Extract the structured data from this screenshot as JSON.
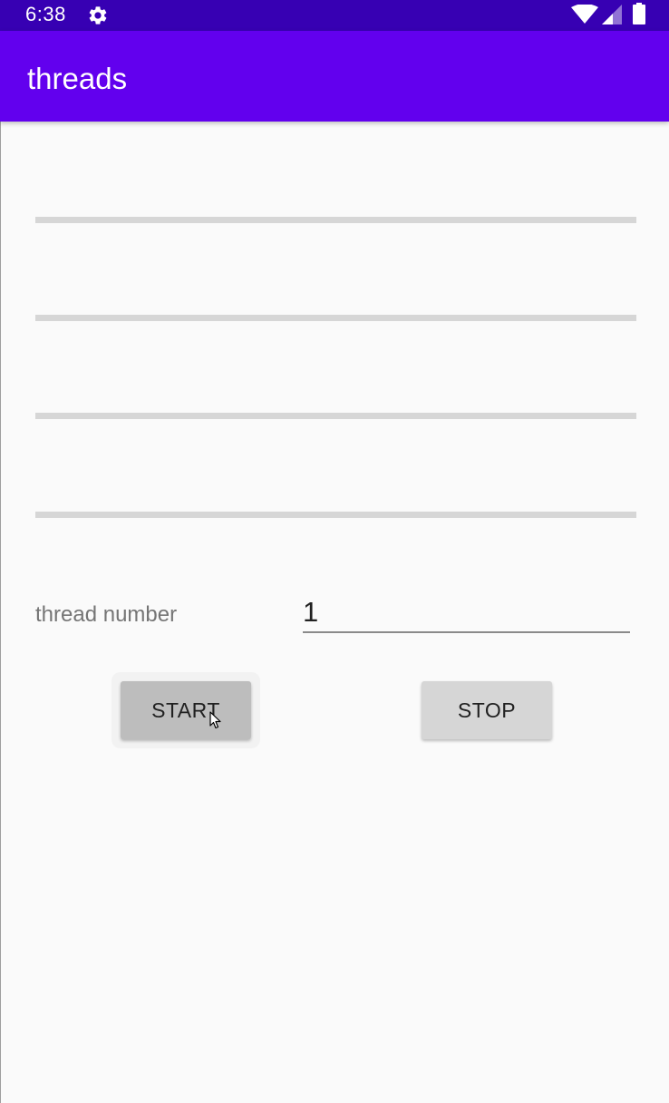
{
  "status_bar": {
    "time": "6:38",
    "icons": [
      "gear-icon",
      "wifi-icon",
      "signal-icon",
      "battery-icon"
    ]
  },
  "app_bar": {
    "title": "threads",
    "color": "#6200ee"
  },
  "colors": {
    "status_bar": "#3700b3",
    "app_bar": "#6200ee",
    "progress_track": "#d6d6d6",
    "button": "#d6d6d6",
    "button_pressed": "#bdbdbd"
  },
  "progress_bars": [
    {
      "progress": 0
    },
    {
      "progress": 0
    },
    {
      "progress": 0
    },
    {
      "progress": 0
    }
  ],
  "form": {
    "thread_label": "thread number",
    "thread_value": "1"
  },
  "buttons": {
    "start_label": "START",
    "stop_label": "STOP"
  }
}
